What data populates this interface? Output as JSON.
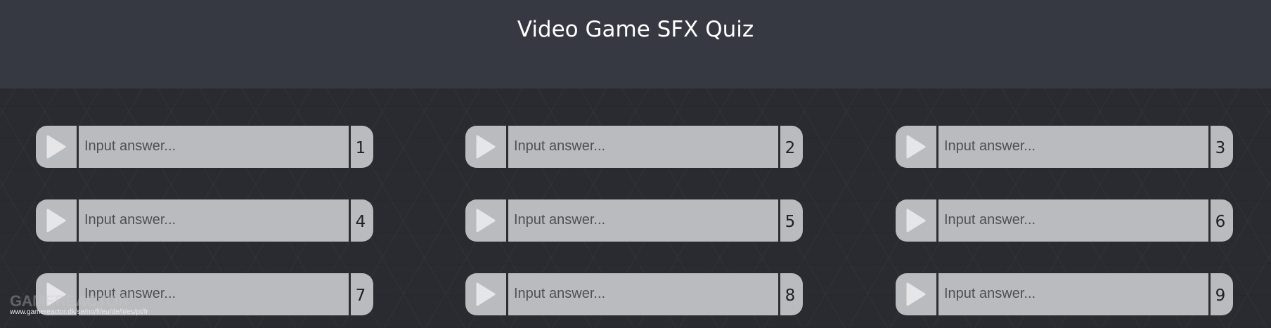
{
  "header": {
    "title": "Video Game SFX Quiz"
  },
  "quiz": {
    "items": [
      {
        "number": "1",
        "placeholder": "Input answer..."
      },
      {
        "number": "2",
        "placeholder": "Input answer..."
      },
      {
        "number": "3",
        "placeholder": "Input answer..."
      },
      {
        "number": "4",
        "placeholder": "Input answer..."
      },
      {
        "number": "5",
        "placeholder": "Input answer..."
      },
      {
        "number": "6",
        "placeholder": "Input answer..."
      },
      {
        "number": "7",
        "placeholder": "Input answer..."
      },
      {
        "number": "8",
        "placeholder": "Input answer..."
      },
      {
        "number": "9",
        "placeholder": "Input answer..."
      }
    ],
    "play_icon": "play-icon"
  },
  "watermark": {
    "logo": "GAMEREACTOR",
    "url": "www.gamereactor.dk/se/no/fi/eu/de/it/es/pt/fr"
  },
  "colors": {
    "header_bg": "#363941",
    "page_bg": "#2a2b30",
    "input_bg": "#babbbe",
    "divider": "#2c2d31",
    "play_icon": "#e6e6e8"
  }
}
